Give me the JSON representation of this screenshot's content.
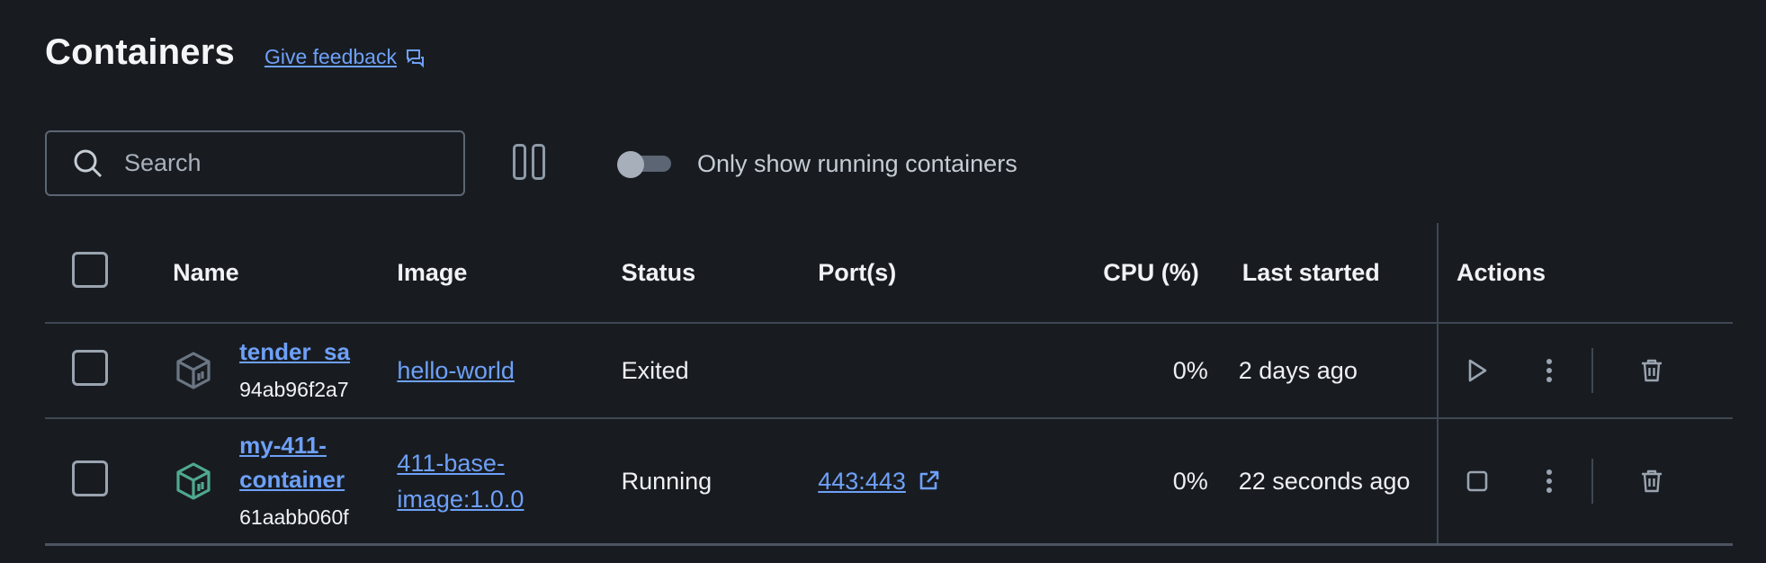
{
  "header": {
    "title": "Containers",
    "feedback_label": "Give feedback"
  },
  "toolbar": {
    "search_placeholder": "Search",
    "toggle_label": "Only show running containers",
    "toggle_on": false
  },
  "table": {
    "columns": [
      "Name",
      "Image",
      "Status",
      "Port(s)",
      "CPU (%)",
      "Last started",
      "Actions"
    ],
    "rows": [
      {
        "name": "tender_sa",
        "id": "94ab96f2a7",
        "image": "hello-world",
        "status": "Exited",
        "ports": "",
        "cpu": "0%",
        "last_started": "2 days ago",
        "running": false
      },
      {
        "name": "my-411-container",
        "id": "61aabb060f",
        "image": "411-base-image:1.0.0",
        "status": "Running",
        "ports": "443:443",
        "cpu": "0%",
        "last_started": "22 seconds ago",
        "running": true
      }
    ]
  },
  "colors": {
    "background": "#181c21",
    "link": "#6ea0f7",
    "running_icon": "#4fa98e",
    "stopped_icon": "#6b7684"
  }
}
